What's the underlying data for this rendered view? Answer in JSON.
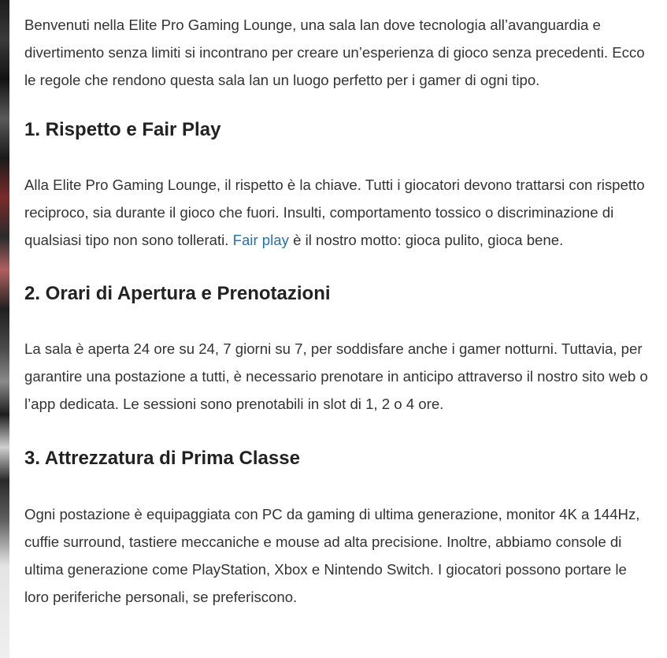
{
  "intro": "Benvenuti nella Elite Pro Gaming Lounge, una sala lan dove tecnologia all’avanguardia e divertimento senza limiti si incontrano per creare un’esperienza di gioco senza precedenti. Ecco le regole che rendono questa sala lan un luogo perfetto per i gamer di ogni tipo.",
  "sections": [
    {
      "heading": "1. Rispetto e Fair Play",
      "body_before": "Alla Elite Pro Gaming Lounge, il rispetto è la chiave. Tutti i giocatori devono trattarsi con rispetto reciproco, sia durante il gioco che fuori. Insulti, comportamento tossico o discriminazione di qualsiasi tipo non sono tollerati. ",
      "link_text": "Fair play",
      "body_after": " è il nostro motto: gioca pulito, gioca bene."
    },
    {
      "heading": "2. Orari di Apertura e Prenotazioni",
      "body": "La sala è aperta 24 ore su 24, 7 giorni su 7, per soddisfare anche i gamer notturni. Tuttavia, per garantire una postazione a tutti, è necessario prenotare in anticipo attraverso il nostro sito web o l’app dedicata. Le sessioni sono prenotabili in slot di 1, 2 o 4 ore."
    },
    {
      "heading": "3. Attrezzatura di Prima Classe",
      "body": "Ogni postazione è equipaggiata con PC da gaming di ultima generazione, monitor 4K a 144Hz, cuffie surround, tastiere meccaniche e mouse ad alta precisione. Inoltre, abbiamo console di ultima generazione come PlayStation, Xbox e Nintendo Switch. I giocatori possono portare le loro periferiche personali, se preferiscono."
    }
  ],
  "colors": {
    "text": "#333333",
    "heading": "#222222",
    "link": "#1e73be",
    "background": "#ffffff"
  }
}
